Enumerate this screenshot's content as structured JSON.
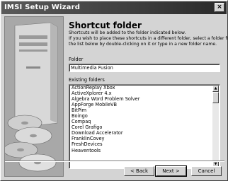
{
  "window": {
    "title": "IMSI Setup Wizard",
    "close_glyph": "×"
  },
  "page": {
    "heading": "Shortcut folder",
    "description": [
      "Shortcuts will be added to the folder indicated below.",
      "If you wish to place these shortcuts in a different folder, select a folder from",
      "the list below by double-clicking on it or type in a new folder name."
    ]
  },
  "folder": {
    "label": "Folder",
    "value": "Multimedia Fusion"
  },
  "existing": {
    "label": "Existing folders",
    "items": [
      "ActionReplay Xbox",
      "ActiveXplorer 4.x",
      "Algebra Word Problem Solver",
      "AppForge MobileVB",
      "BitPim",
      "Boingo",
      "Compaq",
      "Corel Grafigo",
      "Download Accelerator",
      "FranklinCovey",
      "FreshDevices",
      "Heaventools"
    ]
  },
  "buttons": {
    "back": "< Back",
    "next": "Next >",
    "cancel": "Cancel"
  }
}
